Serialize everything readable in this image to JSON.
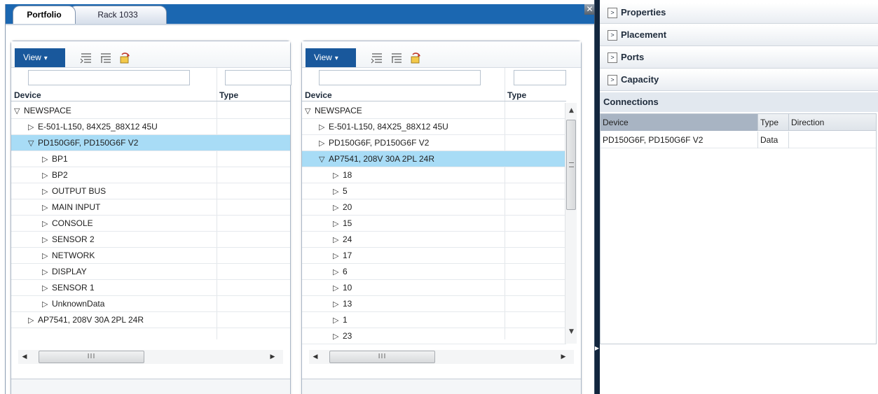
{
  "window": {
    "tabs": [
      {
        "label": "Portfolio",
        "active": true
      },
      {
        "label": "Rack 1033",
        "active": false
      }
    ],
    "close_icon": "close-icon"
  },
  "left_tree": {
    "view_label": "View",
    "filter_device": "",
    "filter_type": "",
    "columns": [
      "Device",
      "Type"
    ],
    "rows": [
      {
        "label": "NEWSPACE",
        "depth": 0,
        "expanded": true,
        "selected": false
      },
      {
        "label": "E-501-L150, 84X25_88X12 45U",
        "depth": 1,
        "expanded": false,
        "selected": false
      },
      {
        "label": "PD150G6F, PD150G6F V2",
        "depth": 1,
        "expanded": true,
        "selected": true
      },
      {
        "label": "BP1",
        "depth": 2,
        "expanded": false,
        "selected": false
      },
      {
        "label": "BP2",
        "depth": 2,
        "expanded": false,
        "selected": false
      },
      {
        "label": "OUTPUT BUS",
        "depth": 2,
        "expanded": false,
        "selected": false
      },
      {
        "label": "MAIN INPUT",
        "depth": 2,
        "expanded": false,
        "selected": false
      },
      {
        "label": "CONSOLE",
        "depth": 2,
        "expanded": false,
        "selected": false
      },
      {
        "label": "SENSOR 2",
        "depth": 2,
        "expanded": false,
        "selected": false
      },
      {
        "label": "NETWORK",
        "depth": 2,
        "expanded": false,
        "selected": false
      },
      {
        "label": "DISPLAY",
        "depth": 2,
        "expanded": false,
        "selected": false
      },
      {
        "label": "SENSOR 1",
        "depth": 2,
        "expanded": false,
        "selected": false
      },
      {
        "label": "UnknownData",
        "depth": 2,
        "expanded": false,
        "selected": false
      },
      {
        "label": "AP7541, 208V 30A 2PL 24R",
        "depth": 1,
        "expanded": false,
        "selected": false
      }
    ]
  },
  "right_tree": {
    "view_label": "View",
    "filter_device": "",
    "filter_type": "",
    "columns": [
      "Device",
      "Type"
    ],
    "rows": [
      {
        "label": "NEWSPACE",
        "depth": 0,
        "expanded": true,
        "selected": false
      },
      {
        "label": "E-501-L150, 84X25_88X12 45U",
        "depth": 1,
        "expanded": false,
        "selected": false
      },
      {
        "label": "PD150G6F, PD150G6F V2",
        "depth": 1,
        "expanded": false,
        "selected": false
      },
      {
        "label": "AP7541, 208V 30A 2PL 24R",
        "depth": 1,
        "expanded": true,
        "selected": true
      },
      {
        "label": "18",
        "depth": 2,
        "expanded": false,
        "selected": false
      },
      {
        "label": "5",
        "depth": 2,
        "expanded": false,
        "selected": false
      },
      {
        "label": "20",
        "depth": 2,
        "expanded": false,
        "selected": false
      },
      {
        "label": "15",
        "depth": 2,
        "expanded": false,
        "selected": false
      },
      {
        "label": "24",
        "depth": 2,
        "expanded": false,
        "selected": false
      },
      {
        "label": "17",
        "depth": 2,
        "expanded": false,
        "selected": false
      },
      {
        "label": "6",
        "depth": 2,
        "expanded": false,
        "selected": false
      },
      {
        "label": "10",
        "depth": 2,
        "expanded": false,
        "selected": false
      },
      {
        "label": "13",
        "depth": 2,
        "expanded": false,
        "selected": false
      },
      {
        "label": "1",
        "depth": 2,
        "expanded": false,
        "selected": false
      },
      {
        "label": "23",
        "depth": 2,
        "expanded": false,
        "selected": false
      }
    ]
  },
  "properties": {
    "sections": [
      {
        "label": "Properties",
        "expanded": false
      },
      {
        "label": "Placement",
        "expanded": false
      },
      {
        "label": "Ports",
        "expanded": false
      },
      {
        "label": "Capacity",
        "expanded": false
      }
    ],
    "connections": {
      "title": "Connections",
      "columns": [
        "Device",
        "Type",
        "Direction"
      ],
      "rows": [
        {
          "device": "PD150G6F, PD150G6F V2",
          "type": "Data",
          "direction": ""
        }
      ]
    }
  },
  "colors": {
    "tab_bar": "#1b67b1",
    "view_button": "#19589c",
    "selected_row": "#a8dcf6",
    "splitter": "#12263e"
  }
}
